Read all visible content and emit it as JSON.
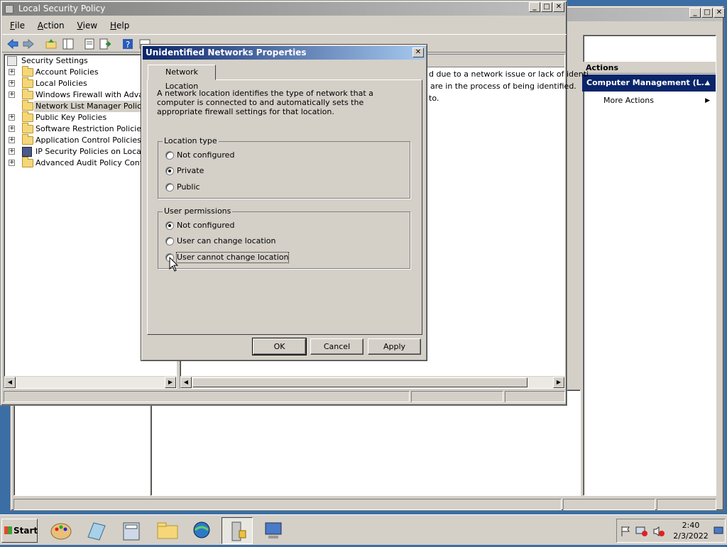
{
  "background_window": {
    "title": "",
    "status_panes": 3
  },
  "main_window": {
    "title": "Local Security Policy",
    "menu": [
      "File",
      "Action",
      "View",
      "Help"
    ],
    "menu_underline": [
      "F",
      "A",
      "V",
      "H"
    ],
    "tree": {
      "root": "Security Settings",
      "items": [
        {
          "label": "Account Policies",
          "expander": "+",
          "icon": "folder-lock-icon"
        },
        {
          "label": "Local Policies",
          "expander": "+",
          "icon": "folder-lock-icon"
        },
        {
          "label": "Windows Firewall with Advance",
          "expander": "+",
          "icon": "folder-icon"
        },
        {
          "label": "Network List Manager Policies",
          "expander": "",
          "icon": "folder-icon",
          "selected": true
        },
        {
          "label": "Public Key Policies",
          "expander": "+",
          "icon": "folder-icon"
        },
        {
          "label": "Software Restriction Policies",
          "expander": "+",
          "icon": "folder-icon"
        },
        {
          "label": "Application Control Policies",
          "expander": "+",
          "icon": "folder-icon"
        },
        {
          "label": "IP Security Policies on Local Cor",
          "expander": "+",
          "icon": "ip-security-icon"
        },
        {
          "label": "Advanced Audit Policy Configur",
          "expander": "+",
          "icon": "folder-icon"
        }
      ]
    },
    "right_pane_text": [
      "d due to a network issue or lack of identi",
      "are in the process of being identified.",
      "to."
    ]
  },
  "actions_pane": {
    "header": "Actions",
    "section": "Computer Management (L...",
    "more_actions": "More Actions"
  },
  "dialog": {
    "title": "Unidentified Networks Properties",
    "tab": "Network Location",
    "description": "A network location identifies the type of network that a computer is connected to and automatically sets the appropriate firewall settings for that location.",
    "location_type": {
      "label": "Location type",
      "options": [
        {
          "label": "Not configured",
          "checked": false
        },
        {
          "label": "Private",
          "checked": true
        },
        {
          "label": "Public",
          "checked": false
        }
      ]
    },
    "user_permissions": {
      "label": "User permissions",
      "options": [
        {
          "label": "Not configured",
          "checked": true
        },
        {
          "label": "User can change location",
          "checked": false
        },
        {
          "label": "User cannot change location",
          "checked": false,
          "focused": true
        }
      ]
    },
    "buttons": {
      "ok": "OK",
      "cancel": "Cancel",
      "apply": "Apply"
    }
  },
  "taskbar": {
    "start": "Start",
    "time": "2:40",
    "date": "2/3/2022"
  }
}
